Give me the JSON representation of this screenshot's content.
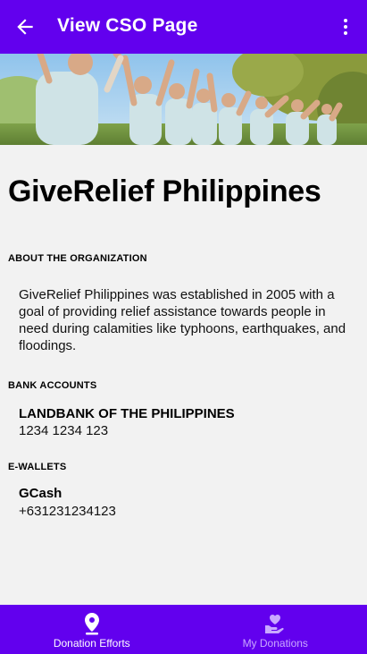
{
  "appbar": {
    "title": "View CSO Page",
    "back_icon": "arrow-left-icon",
    "menu_icon": "more-vertical-icon",
    "color": "#6200ee"
  },
  "banner": {
    "icon": "group-celebration-photo"
  },
  "organization": {
    "name": "GiveRelief Philippines"
  },
  "about": {
    "label": "ABOUT THE ORGANIZATION",
    "text": "GiveRelief Philippines was established in 2005 with a goal of providing relief assistance towards people in need during calamities like typhoons, earthquakes, and floodings."
  },
  "bank_accounts": {
    "label": "BANK ACCOUNTS",
    "items": [
      {
        "name": "LANDBANK OF THE PHILIPPINES",
        "number": "1234 1234 123"
      }
    ]
  },
  "ewallets": {
    "label": "E-WALLETS",
    "items": [
      {
        "name": "GCash",
        "number": "+631231234123"
      }
    ]
  },
  "bottom_nav": {
    "items": [
      {
        "label": "Donation Efforts",
        "icon": "location-pin-icon",
        "active": true
      },
      {
        "label": "My Donations",
        "icon": "heart-hand-icon",
        "active": false
      }
    ],
    "active_color": "#ffffff",
    "inactive_color": "#c9a8ff"
  }
}
